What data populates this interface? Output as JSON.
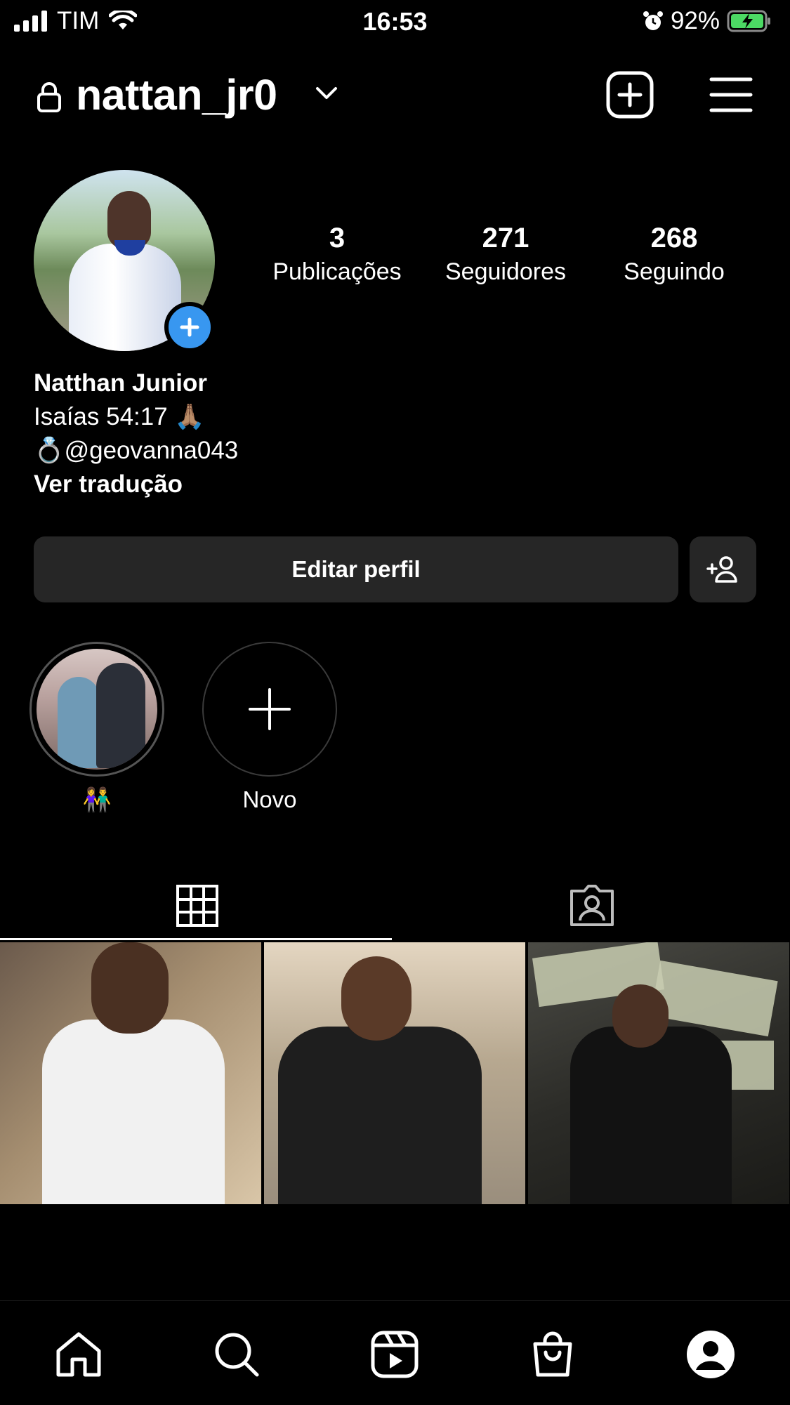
{
  "status_bar": {
    "carrier": "TIM",
    "time": "16:53",
    "battery": "92%",
    "battery_level": 0.92,
    "icons": [
      "cellular-signal-icon",
      "wifi-icon",
      "alarm-icon",
      "battery-charging-icon"
    ]
  },
  "header": {
    "username": "nattan_jr0",
    "icons": [
      "lock-icon",
      "chevron-down-icon",
      "new-post-icon",
      "menu-icon"
    ]
  },
  "profile": {
    "stats": [
      {
        "value": "3",
        "label": "Publicações"
      },
      {
        "value": "271",
        "label": "Seguidores"
      },
      {
        "value": "268",
        "label": "Seguindo"
      }
    ],
    "name": "Natthan Junior",
    "bio_line1": "Isaías 54:17 🙏🏽",
    "bio_line2": "💍@geovanna043",
    "translate_link": "Ver tradução"
  },
  "actions": {
    "edit_profile": "Editar perfil"
  },
  "highlights": [
    {
      "label": "👫"
    },
    {
      "label": "Novo"
    }
  ],
  "tabs": [
    "grid-icon",
    "tagged-icon"
  ],
  "bottom_nav": [
    "home-icon",
    "search-icon",
    "reels-icon",
    "shop-icon",
    "profile-icon"
  ]
}
